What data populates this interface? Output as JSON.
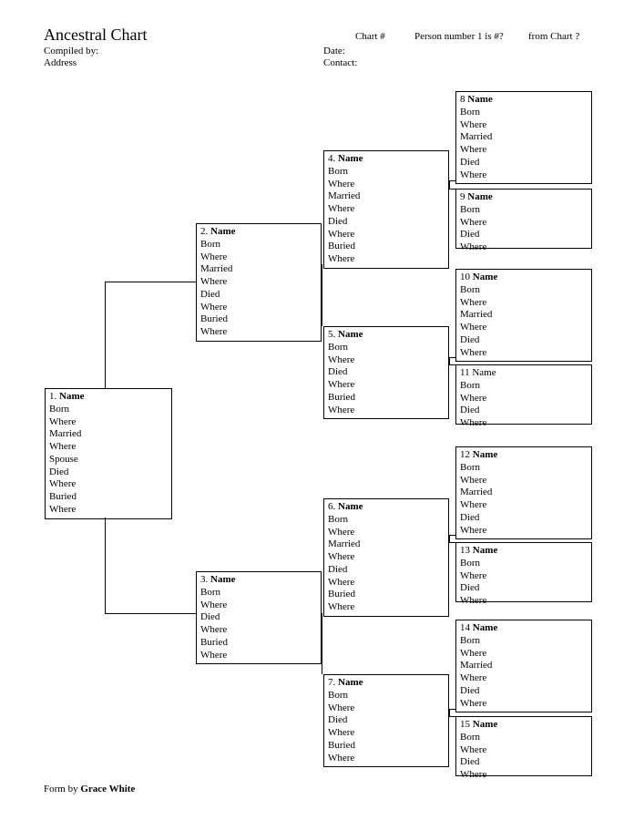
{
  "header": {
    "title": "Ancestral Chart",
    "compiled_by": "Compiled by:",
    "address": "Address",
    "chart_num": "Chart #",
    "person_text": "Person number 1 is #?",
    "from_chart": "from Chart ?",
    "date": "Date:",
    "contact": "Contact:"
  },
  "boxes": {
    "b1": {
      "n": "1.",
      "name": "Name",
      "f": [
        "Born",
        "Where",
        "Married",
        "Where",
        "Spouse",
        "Died",
        "Where",
        "Buried",
        "Where"
      ]
    },
    "b2": {
      "n": "2.",
      "name": "Name",
      "f": [
        "Born",
        "Where",
        "Married",
        "Where",
        "Died",
        "Where",
        "Buried",
        "Where"
      ]
    },
    "b3": {
      "n": "3.",
      "name": "Name",
      "f": [
        "Born",
        "Where",
        "Died",
        "Where",
        "Buried",
        "Where"
      ]
    },
    "b4": {
      "n": "4.",
      "name": "Name",
      "f": [
        "Born",
        "Where",
        "Married",
        "Where",
        "Died",
        "Where",
        "Buried",
        "Where"
      ]
    },
    "b5": {
      "n": "5.",
      "name": "Name",
      "f": [
        "Born",
        "Where",
        "Died",
        "Where",
        "Buried",
        "Where"
      ]
    },
    "b6": {
      "n": "6.",
      "name": "Name",
      "f": [
        "Born",
        "Where",
        "Married",
        "Where",
        "Died",
        "Where",
        "Buried",
        "Where"
      ]
    },
    "b7": {
      "n": "7.",
      "name": "Name",
      "f": [
        "Born",
        "Where",
        "Died",
        "Where",
        "Buried",
        "Where"
      ]
    },
    "b8": {
      "n": "8",
      "name": "Name",
      "f": [
        "Born",
        "Where",
        "Married",
        "Where",
        "Died",
        "Where"
      ]
    },
    "b9": {
      "n": "9",
      "name": "Name",
      "f": [
        "Born",
        "Where",
        "Died",
        "Where"
      ]
    },
    "b10": {
      "n": "10",
      "name": "Name",
      "f": [
        "Born",
        "Where",
        "Married",
        "Where",
        "Died",
        "Where"
      ]
    },
    "b11": {
      "n": "11",
      "name": "Name",
      "f": [
        "Born",
        "Where",
        "Died",
        "Where"
      ]
    },
    "b12": {
      "n": "12",
      "name": "Name",
      "f": [
        "Born",
        "Where",
        "Married",
        "Where",
        "Died",
        "Where"
      ]
    },
    "b13": {
      "n": "13",
      "name": "Name",
      "f": [
        "Born",
        "Where",
        "Died",
        "Where"
      ]
    },
    "b14": {
      "n": "14",
      "name": "Name",
      "f": [
        "Born",
        "Where",
        "Married",
        "Where",
        "Died",
        "Where"
      ]
    },
    "b15": {
      "n": "15",
      "name": "Name",
      "f": [
        "Born",
        "Where",
        "Died",
        "Where"
      ]
    }
  },
  "footer": {
    "form_by": "Form by ",
    "author": "Grace White"
  }
}
